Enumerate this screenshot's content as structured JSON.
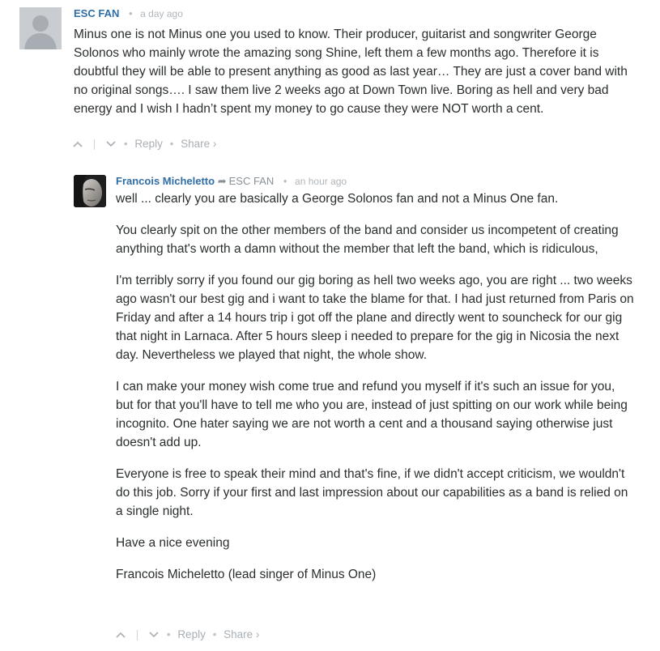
{
  "comments": [
    {
      "author": "ESC FAN",
      "time": "a day ago",
      "avatar": "default-avatar-icon",
      "paragraphs": [
        "Minus one is not Minus one you used to know. Their producer, guitarist and songwriter George Solonos who mainly wrote the amazing song Shine, left them a few months ago. Therefore it is doubtful they will be able to present anything as good as last year… They are just a cover band with no original songs…. I saw them live 2 weeks ago at Down Town live. Boring as hell and very bad energy and I wish I hadn’t spent my money to go cause they were NOT worth a cent."
      ],
      "actions": {
        "reply": "Reply",
        "share": "Share ›"
      }
    },
    {
      "author": "Francois Micheletto",
      "reply_to": "ESC FAN",
      "time": "an hour ago",
      "avatar": "user-photo-avatar",
      "paragraphs": [
        "well ... clearly you are basically a George Solonos fan and not a Minus One fan.",
        "You clearly spit on the other members of the band and consider us incompetent of creating anything that's worth a damn without the member that left the band, which is ridiculous,",
        "I'm terribly sorry if you found our gig boring as hell two weeks ago, you are right ... two weeks ago wasn't our best gig and i want to take the blame for that. I had just returned from Paris on Friday and after a 14 hours trip i got off the plane and directly went to souncheck for our gig that night in Larnaca. After 5 hours sleep i needed to prepare for the gig in Nicosia the next day. Nevertheless we played that night, the whole show.",
        "I can make your money wish come true and refund you myself if it's such an issue for you, but for that you'll have to tell me who you are, instead of just spitting on our work while being incognito. One hater saying we are not worth a cent and a thousand saying otherwise just doesn't add up.",
        "Everyone is free to speak their mind and that's fine, if we didn't accept criticism, we wouldn't do this job. Sorry if your first and last impression about our capabilities as a band is relied on a single night.",
        "Have a nice evening",
        "Francois Micheletto (lead singer of Minus One)"
      ],
      "actions": {
        "reply": "Reply",
        "share": "Share ›"
      }
    }
  ]
}
